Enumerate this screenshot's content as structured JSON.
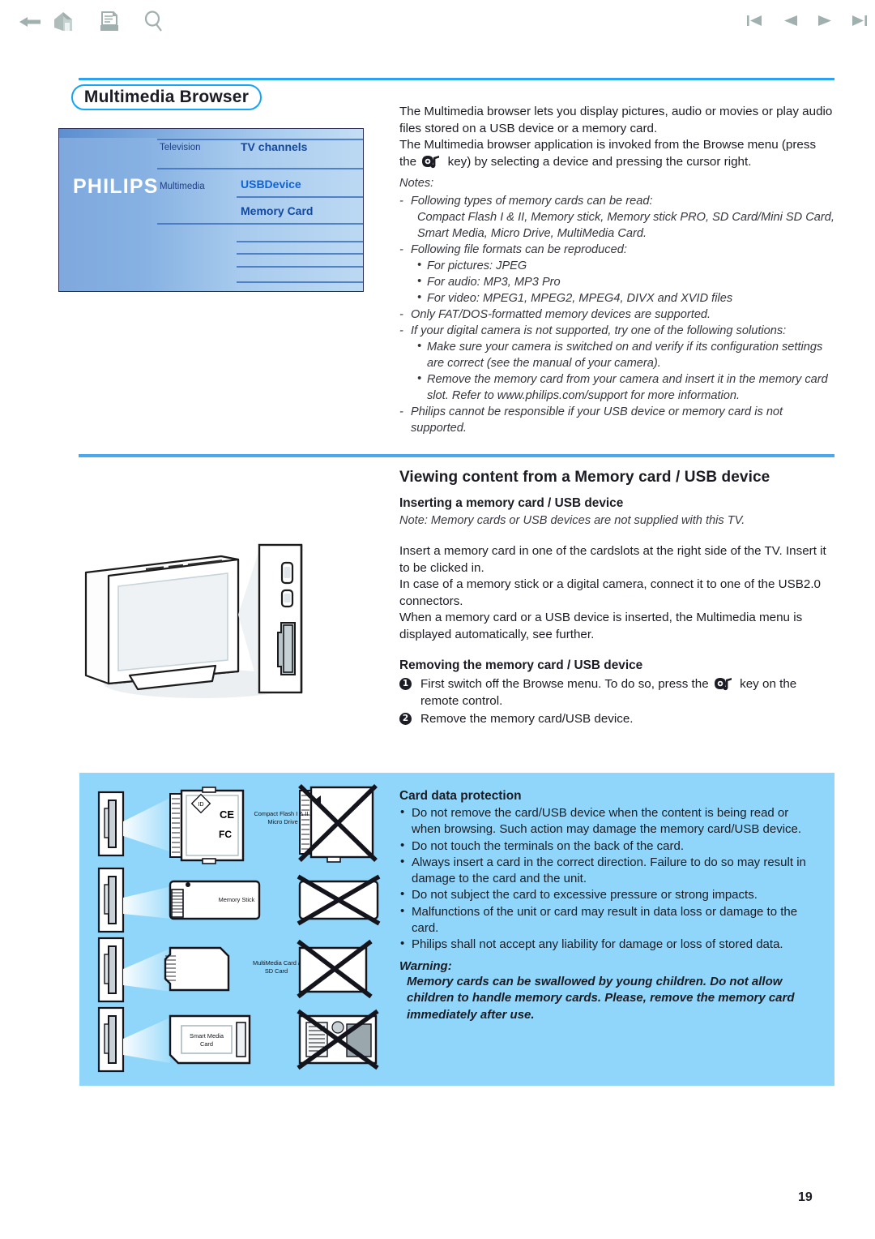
{
  "toolbar": {
    "icons": [
      {
        "name": "back-arrow-icon",
        "label": "Back"
      },
      {
        "name": "home-icon",
        "label": "Home"
      },
      {
        "name": "document-print-icon",
        "label": "Print"
      },
      {
        "name": "search-magnifier-icon",
        "label": "Search"
      },
      {
        "name": "first-page-icon",
        "label": "First page"
      },
      {
        "name": "previous-page-icon",
        "label": "Previous page"
      },
      {
        "name": "next-page-icon",
        "label": "Next page"
      },
      {
        "name": "last-page-icon",
        "label": "Last page"
      }
    ]
  },
  "colors": {
    "rule_blue": "#2aa3f5",
    "title_border": "#12a5f8",
    "panel_blue": "#8fd6fa",
    "osd_highlight_text": "#0e63d8",
    "toolbar_icon": "#9fb0ae"
  },
  "page": {
    "title": "Multimedia Browser",
    "number": "19"
  },
  "osd": {
    "brand": "PHILIPS",
    "col2": [
      {
        "label": "Television"
      },
      {
        "label": "Multimedia"
      }
    ],
    "col3": [
      {
        "label": "TV channels",
        "selected": false
      },
      {
        "label": "USBDevice",
        "selected": true
      },
      {
        "label": "Memory Card",
        "selected": false
      }
    ]
  },
  "intro": {
    "p1": "The Multimedia browser lets you display pictures, audio or movies or play audio files stored on a USB device or a memory card.",
    "p2_before": "The Multimedia browser application is invoked from the Browse menu (press the",
    "p2_after": "key) by selecting a device and pressing the cursor right."
  },
  "notes": {
    "heading": "Notes:",
    "items": [
      {
        "text": "Following types of memory cards can be read:",
        "continuation": "Compact Flash I & II, Memory stick, Memory stick PRO, SD Card/Mini SD Card, Smart Media, Micro Drive, MultiMedia Card."
      },
      {
        "text": "Following file formats can be reproduced:",
        "sub": [
          "For pictures: JPEG",
          "For audio: MP3, MP3 Pro",
          "For video: MPEG1, MPEG2, MPEG4, DIVX and XVID files"
        ]
      },
      {
        "text": "Only FAT/DOS-formatted memory devices are supported."
      },
      {
        "text": "If your digital camera is not supported, try one of the following solutions:",
        "sub": [
          "Make sure your camera is switched on and verify if its configuration settings are correct (see the manual of your camera).",
          "Remove the memory card from your camera and insert it in the memory card slot. Refer to www.philips.com/support for more information."
        ]
      },
      {
        "text": "Philips cannot be responsible if your USB device or memory card is not supported."
      }
    ]
  },
  "section": {
    "heading": "Viewing content from a Memory card / USB device",
    "sub_heading_1": "Inserting a memory card / USB device",
    "note_tv": "Note: Memory cards or USB devices are not supplied with this TV.",
    "paragraphs": [
      "Insert a memory card in one of the cardslots at the right side of the TV. Insert it to be clicked in.",
      "In case of a memory stick or a digital camera, connect it to one of the USB2.0 connectors.",
      "When a memory card or a USB device is inserted, the Multimedia menu is displayed automatically, see further."
    ],
    "sub_heading_2": "Removing the memory card / USB device",
    "steps": [
      {
        "num": "1",
        "before": "First switch off the Browse menu. To do so, press the",
        "after": "key on the remote control."
      },
      {
        "num": "2",
        "before": "Remove the memory card/USB device.",
        "after": ""
      }
    ]
  },
  "card_protection": {
    "heading": "Card data protection",
    "items": [
      "Do not remove the card/USB device when the content is being read or when browsing. Such action may damage the memory card/USB device.",
      "Do not touch the terminals on the back of the card.",
      "Always insert a card in the correct direction. Failure to do so may result in damage to the card and the unit.",
      "Do not subject the card to excessive pressure or strong impacts.",
      "Malfunctions of the unit or card may result in data loss or damage to the card.",
      "Philips shall not accept any liability for damage or loss of stored data."
    ]
  },
  "warning": {
    "title": "Warning:",
    "body": "Memory cards can be swallowed by young children. Do not allow children to handle memory cards. Please, remove the memory card immediately after use."
  },
  "card_diagram": {
    "labels": [
      {
        "line1": "Compact Flash I & II /",
        "line2": "Micro Drive"
      },
      {
        "line1": "Memory Stick",
        "line2": ""
      },
      {
        "line1": "MultiMedia Card /",
        "line2": "SD Card"
      },
      {
        "line1": "Smart Media",
        "line2": "Card"
      }
    ]
  }
}
